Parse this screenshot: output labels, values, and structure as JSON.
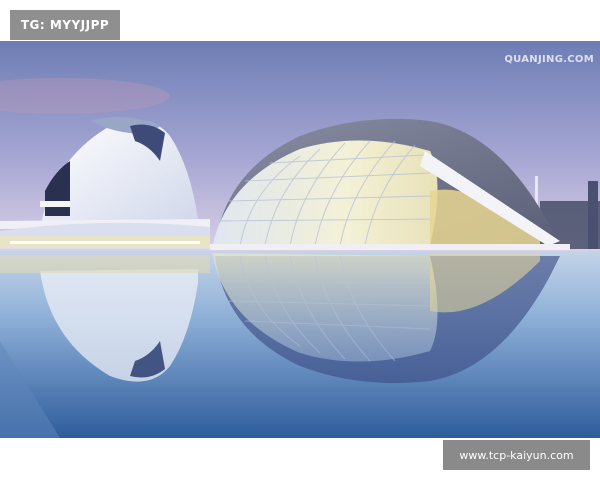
{
  "overlays": {
    "tag_label": "TG: MYYJJPP",
    "url_label": "www.tcp-kaiyun.com"
  },
  "photo": {
    "watermark": "QUANJING.COM",
    "colors": {
      "sky_top": "#6f7fb6",
      "sky_bottom": "#d9cfe4",
      "water_top": "#a9c0dd",
      "water_bottom": "#2f5e9c",
      "glass_glow": "#f2f0d0",
      "roof_grey": "#6e7288"
    }
  }
}
